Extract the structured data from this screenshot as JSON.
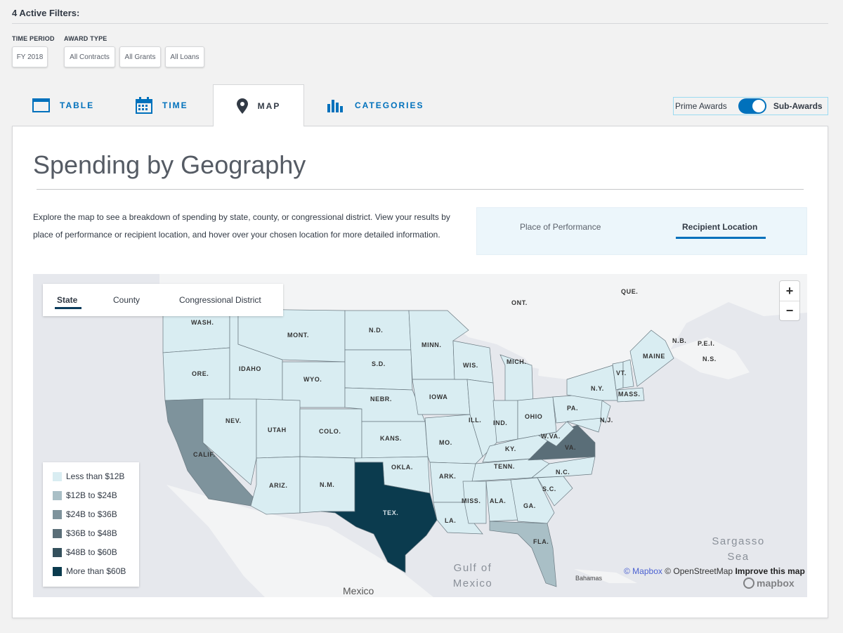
{
  "filters": {
    "title": "4 Active Filters:",
    "groups": [
      {
        "label": "TIME PERIOD",
        "chips": [
          "FY 2018"
        ]
      },
      {
        "label": "AWARD TYPE",
        "chips": [
          "All Contracts",
          "All Grants",
          "All Loans"
        ]
      }
    ]
  },
  "tabs": [
    {
      "label": "TABLE",
      "icon": "table-icon"
    },
    {
      "label": "TIME",
      "icon": "calendar-icon"
    },
    {
      "label": "MAP",
      "icon": "map-pin-icon",
      "active": true
    },
    {
      "label": "CATEGORIES",
      "icon": "bar-chart-icon"
    }
  ],
  "award_toggle": {
    "left": "Prime Awards",
    "right": "Sub-Awards",
    "selected": "Sub-Awards"
  },
  "panel": {
    "title": "Spending by Geography",
    "description": "Explore the map to see a breakdown of spending by state, county, or congressional district. View your results by place of performance or recipient location, and hover over your chosen location for more detailed information."
  },
  "location_tabs": {
    "inactive": "Place of Performance",
    "active": "Recipient Location"
  },
  "map": {
    "scopes": [
      "State",
      "County",
      "Congressional District"
    ],
    "selected_scope": "State",
    "zoom_in": "+",
    "zoom_out": "−",
    "legend": [
      {
        "label": "Less than $12B",
        "color": "#d9edf2"
      },
      {
        "label": "$12B to $24B",
        "color": "#a9bfc6"
      },
      {
        "label": "$24B to $36B",
        "color": "#7e939c"
      },
      {
        "label": "$36B to $48B",
        "color": "#5a6e78"
      },
      {
        "label": "$48B to $60B",
        "color": "#34505c"
      },
      {
        "label": "More than $60B",
        "color": "#0b3b4e"
      }
    ],
    "state_labels": [
      "WASH.",
      "MONT.",
      "N.D.",
      "MINN.",
      "ORE.",
      "IDAHO",
      "S.D.",
      "WIS.",
      "MICH.",
      "WYO.",
      "NEBR.",
      "IOWA",
      "N.Y.",
      "VT.",
      "MAINE",
      "NEV.",
      "UTAH",
      "COLO.",
      "KANS.",
      "MO.",
      "ILL.",
      "IND.",
      "OHIO",
      "PA.",
      "MASS.",
      "N.J.",
      "W.VA.",
      "VA.",
      "KY.",
      "CALIF.",
      "OKLA.",
      "TENN.",
      "N.C.",
      "ARK.",
      "ARIZ.",
      "N.M.",
      "S.C.",
      "MISS.",
      "ALA.",
      "GA.",
      "TEX.",
      "LA.",
      "FLA."
    ],
    "region_labels": [
      "ONT.",
      "QUE.",
      "N.B.",
      "P.E.I.",
      "N.S."
    ],
    "water_labels": [
      "Gulf of Mexico",
      "Sargasso Sea"
    ],
    "place_labels": [
      "Mexico",
      "Bahamas"
    ],
    "attribution": {
      "mapbox": "© Mapbox",
      "osm": "© OpenStreetMap",
      "improve": "Improve this map",
      "logo": "mapbox"
    }
  }
}
